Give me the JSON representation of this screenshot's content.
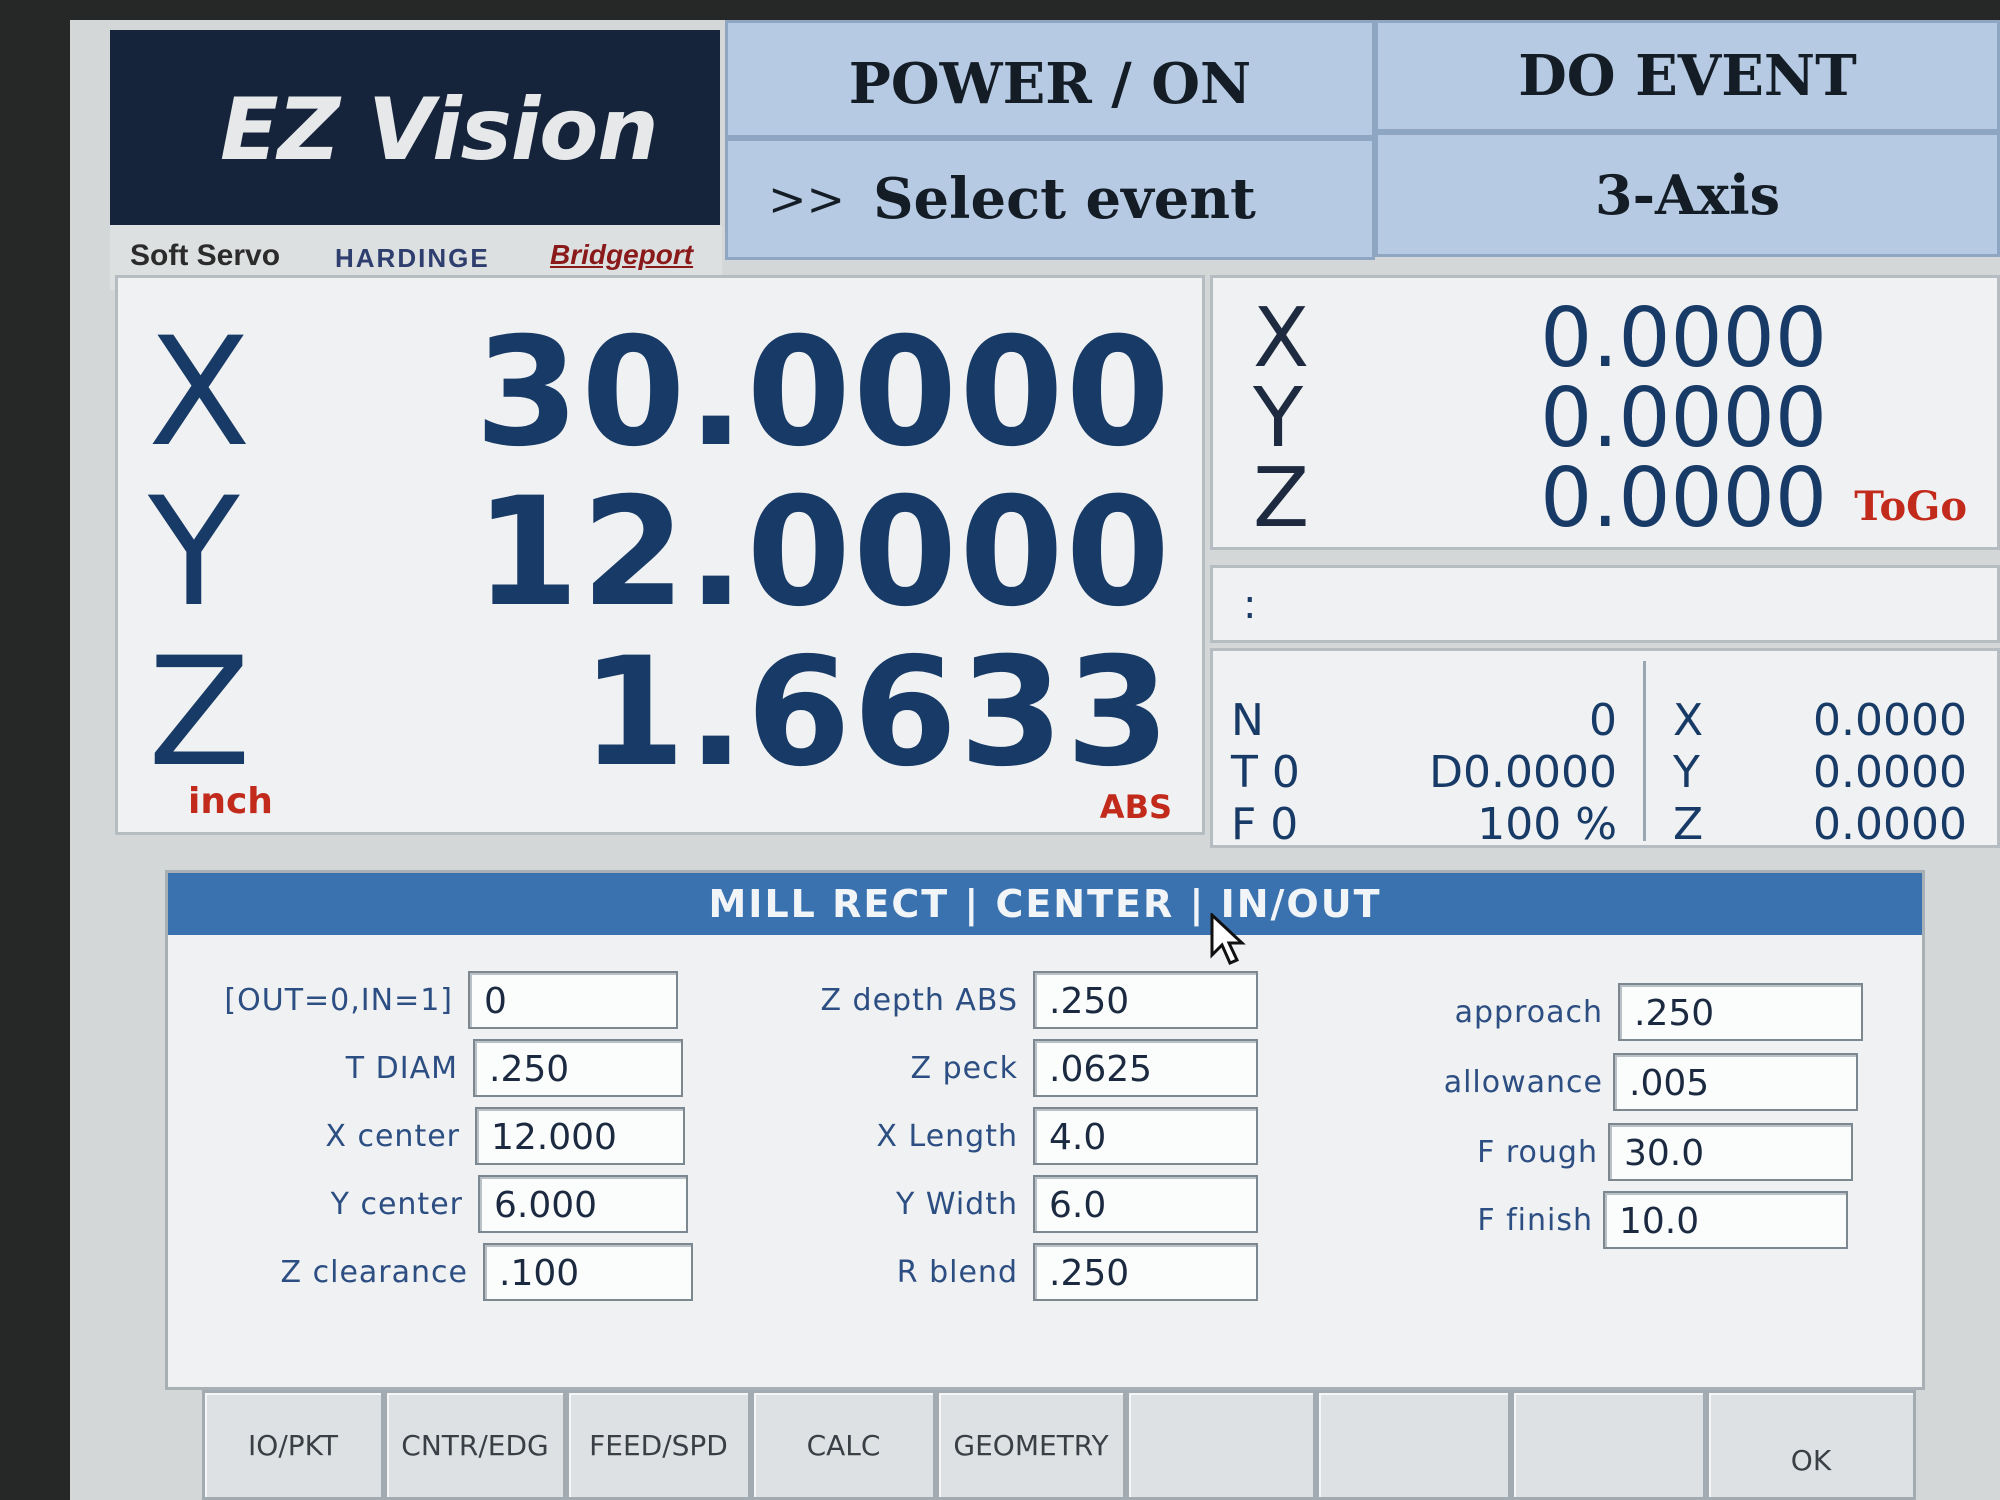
{
  "header": {
    "app_title": "EZ Vision",
    "brands": [
      "Soft Servo",
      "HARDINGE",
      "Bridgeport"
    ],
    "power_status": "POWER / ON",
    "do_event_button": "DO EVENT",
    "prompt_symbol": ">>",
    "prompt_text": "Select event",
    "axis_mode": "3-Axis"
  },
  "position": {
    "axes": [
      {
        "axis": "X",
        "value": "30.0000"
      },
      {
        "axis": "Y",
        "value": "12.0000"
      },
      {
        "axis": "Z",
        "value": "1.6633"
      }
    ],
    "unit": "inch",
    "mode": "ABS"
  },
  "togo": {
    "axes": [
      {
        "axis": "X",
        "value": "0.0000"
      },
      {
        "axis": "Y",
        "value": "0.0000"
      },
      {
        "axis": "Z",
        "value": "0.0000"
      }
    ],
    "label": "ToGo"
  },
  "command_line": ":",
  "status": {
    "n_label": "N",
    "n_value": "0",
    "t_label": "T 0",
    "t_value": "D0.0000",
    "f_label": "F 0",
    "f_value": "100 %",
    "axes": [
      {
        "axis": "X",
        "value": "0.0000"
      },
      {
        "axis": "Y",
        "value": "0.0000"
      },
      {
        "axis": "Z",
        "value": "0.0000"
      }
    ]
  },
  "form": {
    "title": "MILL RECT | CENTER | IN/OUT",
    "col1": [
      {
        "label": "[OUT=0,IN=1]",
        "value": "0"
      },
      {
        "label": "T DIAM",
        "value": ".250"
      },
      {
        "label": "X center",
        "value": "12.000"
      },
      {
        "label": "Y center",
        "value": "6.000"
      },
      {
        "label": "Z clearance",
        "value": ".100"
      }
    ],
    "col2": [
      {
        "label": "Z depth ABS",
        "value": ".250"
      },
      {
        "label": "Z peck",
        "value": ".0625"
      },
      {
        "label": "X Length",
        "value": "4.0"
      },
      {
        "label": "Y Width",
        "value": "6.0"
      },
      {
        "label": "R blend",
        "value": ".250"
      }
    ],
    "col3": [
      {
        "label": "approach",
        "value": ".250"
      },
      {
        "label": "allowance",
        "value": ".005"
      },
      {
        "label": "F rough",
        "value": "30.0"
      },
      {
        "label": "F finish",
        "value": "10.0"
      }
    ]
  },
  "function_keys": [
    "IO/PKT",
    "CNTR/EDG",
    "FEED/SPD",
    "CALC",
    "GEOMETRY",
    "",
    "",
    "",
    "OK"
  ],
  "colors": {
    "accent": "#3a72b0",
    "readout": "#183a66",
    "alert": "#c22a1c",
    "header_bg": "#b6cbe3"
  }
}
